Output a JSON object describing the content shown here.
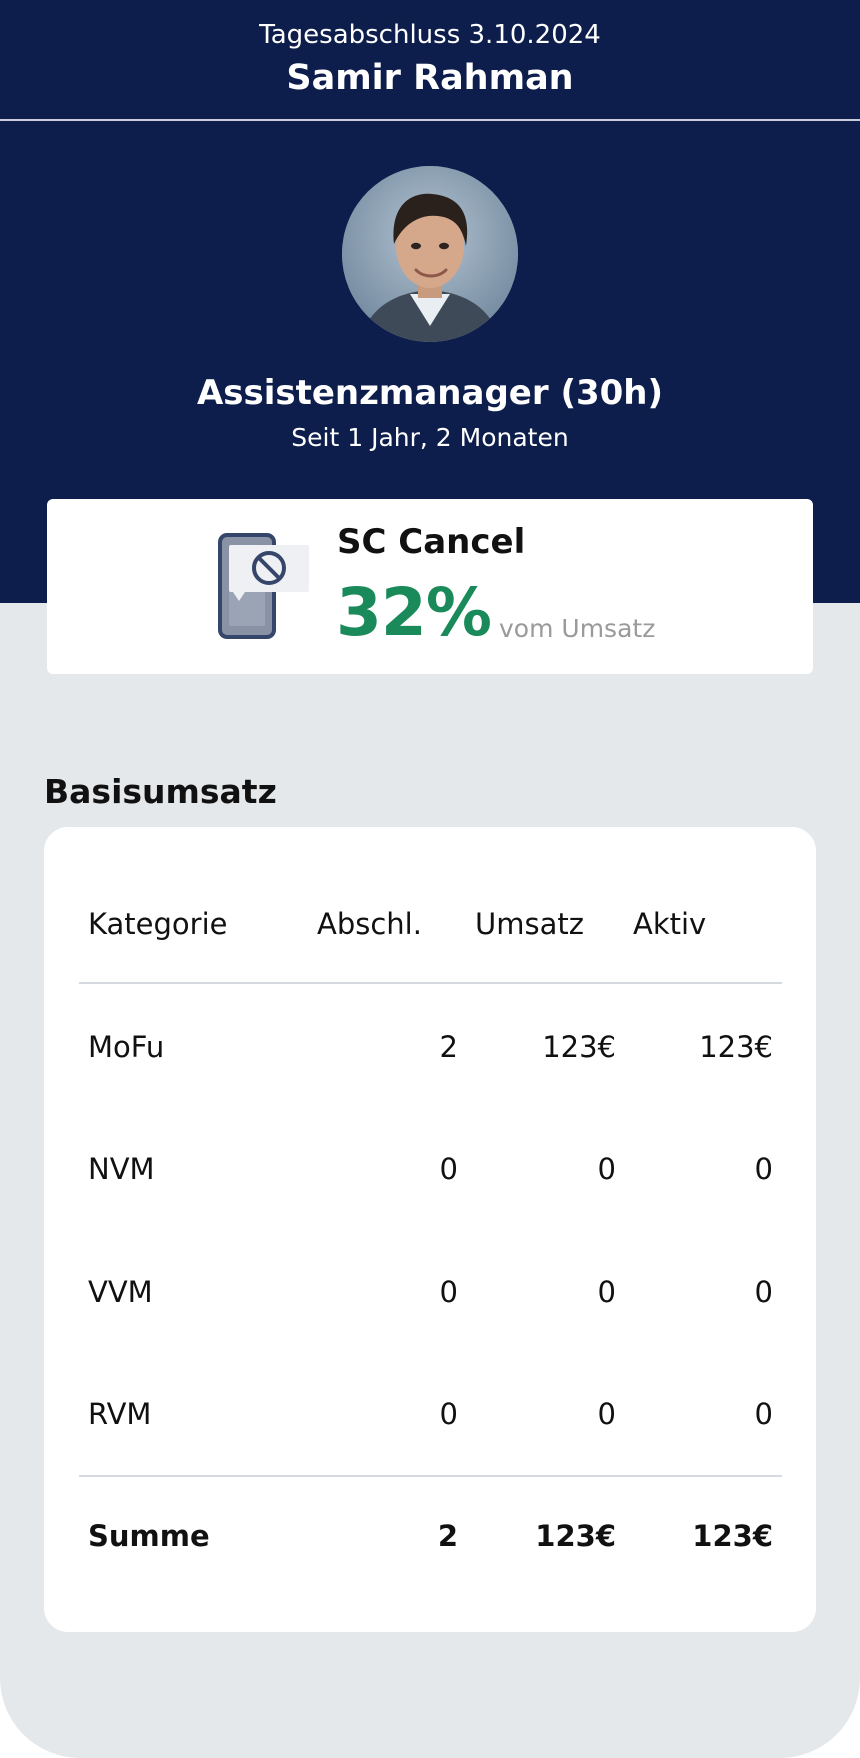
{
  "header": {
    "subtitle": "Tagesabschluss 3.10.2024",
    "name": "Samir Rahman"
  },
  "profile": {
    "avatar_icon": "person-photo-icon",
    "role": "Assistenzmanager (30h)",
    "tenure": "Seit 1 Jahr, 2 Monaten"
  },
  "kpi": {
    "icon": "phone-cancel-icon",
    "title": "SC Cancel",
    "value": "32%",
    "unit": "vom Umsatz",
    "accent_color": "#1a8a5a"
  },
  "basisumsatz": {
    "title": "Basisumsatz",
    "columns": [
      "Kategorie",
      "Abschl.",
      "Umsatz",
      "Aktiv"
    ],
    "rows": [
      [
        "MoFu",
        "2",
        "123€",
        "123€"
      ],
      [
        "NVM",
        "0",
        "0",
        "0"
      ],
      [
        "VVM",
        "0",
        "0",
        "0"
      ],
      [
        "RVM",
        "0",
        "0",
        "0"
      ]
    ],
    "total": [
      "Summe",
      "2",
      "123€",
      "123€"
    ]
  },
  "colors": {
    "header_background": "#0d1e4c",
    "page_background": "#e5e8eb",
    "card_background": "#ffffff"
  }
}
